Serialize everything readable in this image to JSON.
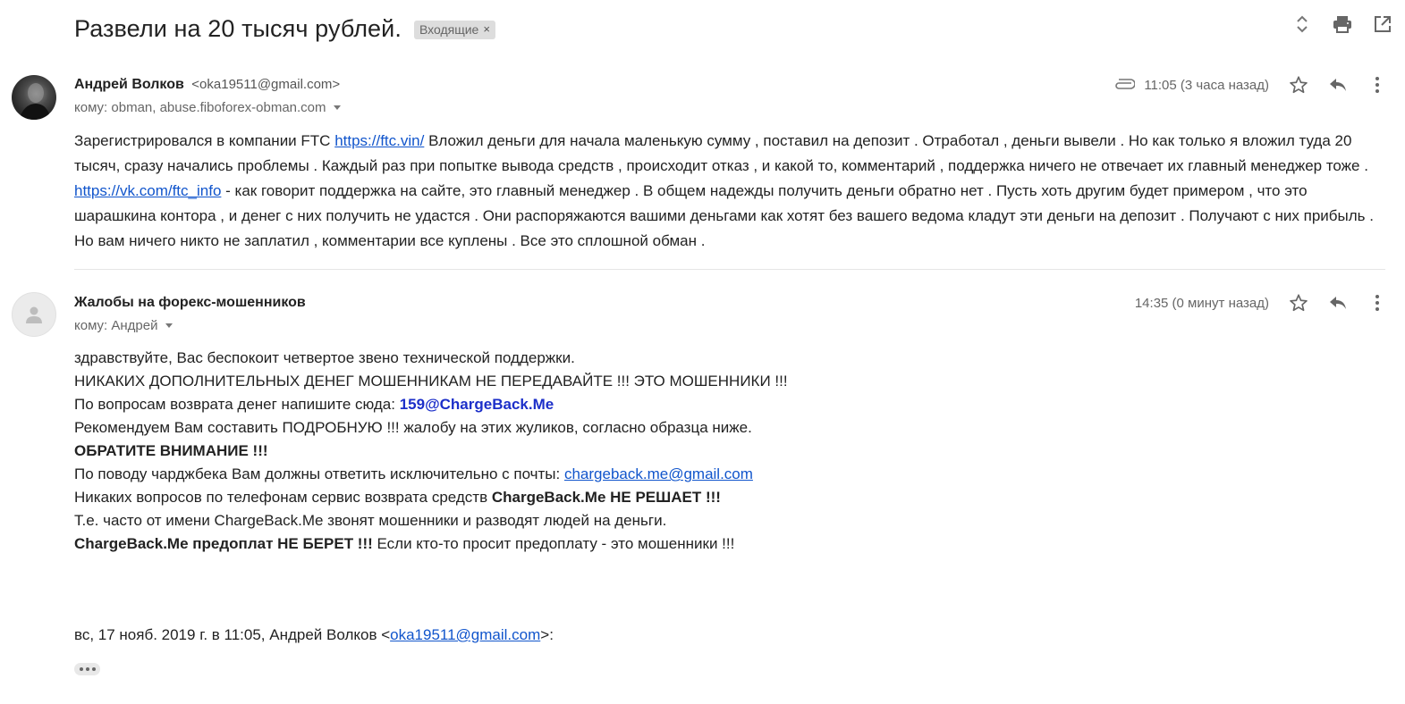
{
  "header": {
    "subject": "Развели на 20 тысяч рублей.",
    "label": "Входящие",
    "label_remove": "×"
  },
  "messages": [
    {
      "sender_name": "Андрей Волков",
      "sender_email": "<oka19511@gmail.com>",
      "to": "кому: obman, abuse.fiboforex-obman.com",
      "time": "11:05 (3 часа назад)",
      "body": {
        "p1": "Зарегистрировался в компании FTC ",
        "link1": "https://ftc.vin/",
        "p2": " Вложил деньги   для начала маленькую сумму , поставил на депозит . Отработал , деньги вывели . Но как только я вложил туда 20 тысяч, сразу начались проблемы . Каждый раз при попытке вывода средств , происходит отказ , и какой то, комментарий , поддержка ничего не отвечает   их главный менеджер тоже . ",
        "link2": "https://vk.com/ftc_info",
        "p3": " - как говорит поддержка на сайте, это главный менеджер . В общем надежды получить деньги обратно нет . Пусть хоть другим будет примером , что это шарашкина контора , и денег с них получить не удастся . Они распоряжаются вашими деньгами как хотят   без вашего ведома кладут эти деньги на депозит   . Получают с них прибыль . Но вам ничего никто не заплатил , комментарии все куплены   . Все это сплошной обман ."
      }
    },
    {
      "sender_name": "Жалобы на форекс-мошенников",
      "to": "кому: Андрей",
      "time": "14:35 (0 минут назад)",
      "body": {
        "l1": "здравствуйте, Вас беспокоит четвертое звено технической поддержки.",
        "l2": "НИКАКИХ ДОПОЛНИТЕЛЬНЫХ ДЕНЕГ МОШЕННИКАМ НЕ ПЕРЕДАВАЙТЕ !!! ЭТО МОШЕННИКИ !!!",
        "l3a": "По вопросам возврата денег напишите сюда: ",
        "l3b": "159@ChargeBack.Me",
        "l4": "Рекомендуем Вам составить ПОДРОБНУЮ !!! жалобу на этих жуликов, согласно образца ниже.",
        "l5": "ОБРАТИТЕ ВНИМАНИЕ !!!",
        "l6a": "По поводу чарджбека Вам должны ответить исключительно с почты: ",
        "l6b": "chargeback.me@gmail.com",
        "l7a": "Никаких вопросов по телефонам сервис возврата средств ",
        "l7b": "ChargeBack.Me НЕ РЕШАЕТ !!!",
        "l8": "Т.е. часто от имени ChargeBack.Me звонят мошенники и разводят людей на деньги.",
        "l9a": "ChargeBack.Me предоплат НЕ БЕРЕТ !!!",
        "l9b": " Если кто-то просит предоплату - это мошенники !!!",
        "quote_prefix": "вс, 17 нояб. 2019 г. в 11:05, Андрей Волков <",
        "quote_email": "oka19511@gmail.com",
        "quote_suffix": ">:"
      }
    }
  ],
  "colors": {
    "link": "#1155cc",
    "chargeback": "#1c2fc9",
    "label_bg": "#dddddd"
  }
}
